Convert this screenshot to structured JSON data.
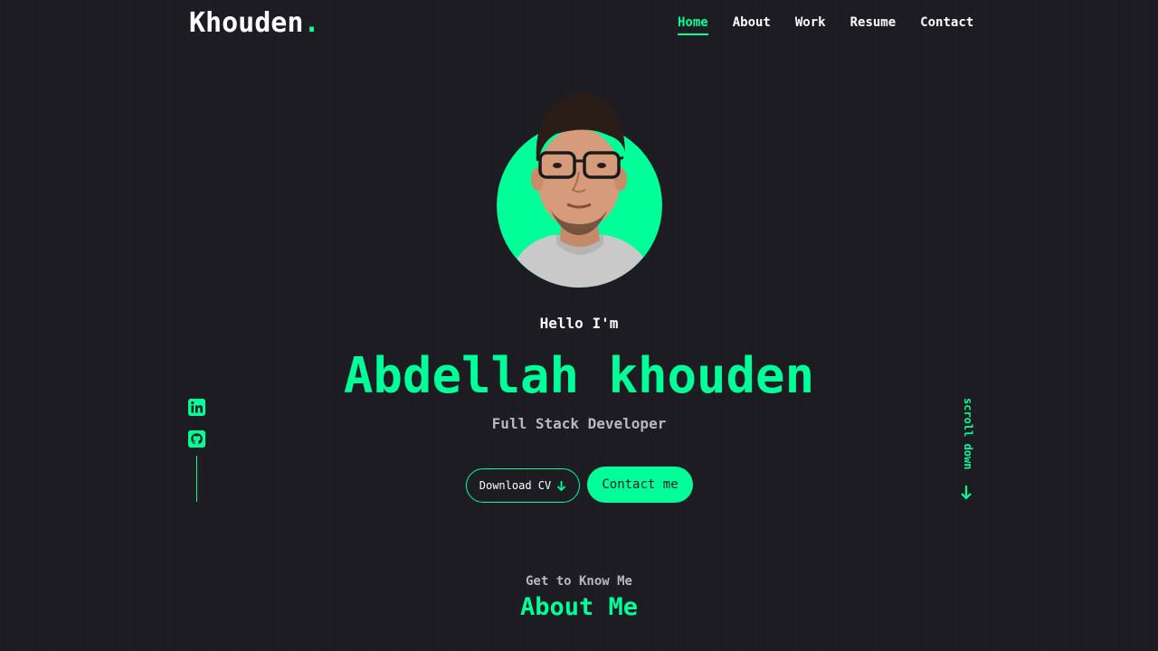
{
  "header": {
    "logo_text": "Khouden",
    "logo_dot": ".",
    "nav": [
      {
        "label": "Home",
        "active": true
      },
      {
        "label": "About",
        "active": false
      },
      {
        "label": "Work",
        "active": false
      },
      {
        "label": "Resume",
        "active": false
      },
      {
        "label": "Contact",
        "active": false
      }
    ]
  },
  "hero": {
    "greeting": "Hello I'm",
    "name": "Abdellah khouden",
    "role": "Full Stack Developer",
    "download_cv_label": "Download CV",
    "download_cv_icon": "arrow-down-icon",
    "contact_label": "Contact me"
  },
  "socials": [
    {
      "name": "linkedin-icon"
    },
    {
      "name": "github-icon"
    }
  ],
  "scroll": {
    "label": "scroll down",
    "icon": "arrow-down-icon"
  },
  "about": {
    "subtitle": "Get to Know Me",
    "title": "About Me"
  },
  "colors": {
    "accent": "#00ff99",
    "background": "#1c1c22",
    "muted": "#b8b8be"
  }
}
